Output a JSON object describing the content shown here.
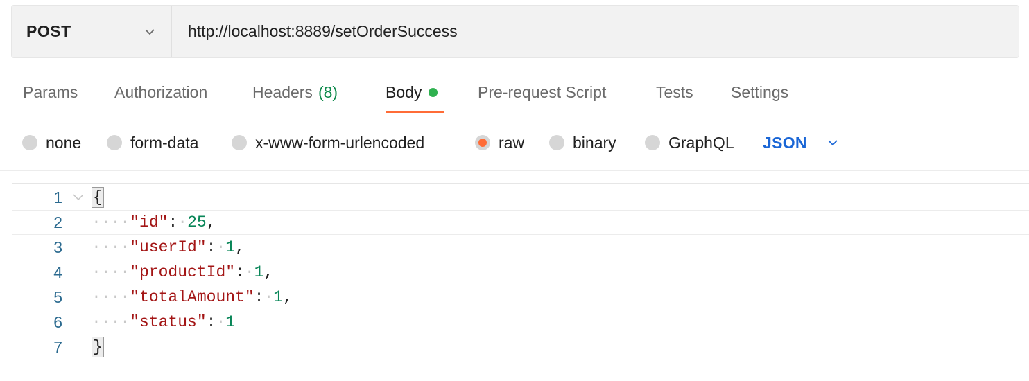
{
  "request": {
    "method": "POST",
    "url": "http://localhost:8889/setOrderSuccess"
  },
  "tabs": [
    {
      "label": "Params"
    },
    {
      "label": "Authorization"
    },
    {
      "label": "Headers",
      "count": "(8)"
    },
    {
      "label": "Body",
      "active": true,
      "indicator": "green-dot"
    },
    {
      "label": "Pre-request Script"
    },
    {
      "label": "Tests"
    },
    {
      "label": "Settings"
    }
  ],
  "body_types": [
    {
      "label": "none",
      "selected": false
    },
    {
      "label": "form-data",
      "selected": false
    },
    {
      "label": "x-www-form-urlencoded",
      "selected": false
    },
    {
      "label": "raw",
      "selected": true
    },
    {
      "label": "binary",
      "selected": false
    },
    {
      "label": "GraphQL",
      "selected": false
    }
  ],
  "raw_language": "JSON",
  "editor": {
    "lines": [
      {
        "n": "1",
        "text": "{"
      },
      {
        "n": "2",
        "key": "\"id\"",
        "value": "25",
        "comma": ","
      },
      {
        "n": "3",
        "key": "\"userId\"",
        "value": "1",
        "comma": ","
      },
      {
        "n": "4",
        "key": "\"productId\"",
        "value": "1",
        "comma": ","
      },
      {
        "n": "5",
        "key": "\"totalAmount\"",
        "value": "1",
        "comma": ","
      },
      {
        "n": "6",
        "key": "\"status\"",
        "value": "1",
        "comma": ""
      },
      {
        "n": "7",
        "text": "}"
      }
    ]
  },
  "colors": {
    "accent": "#ff6c37",
    "json_link": "#1a66d6",
    "body_dot": "#2fb150",
    "key": "#a31515",
    "number": "#098658"
  }
}
